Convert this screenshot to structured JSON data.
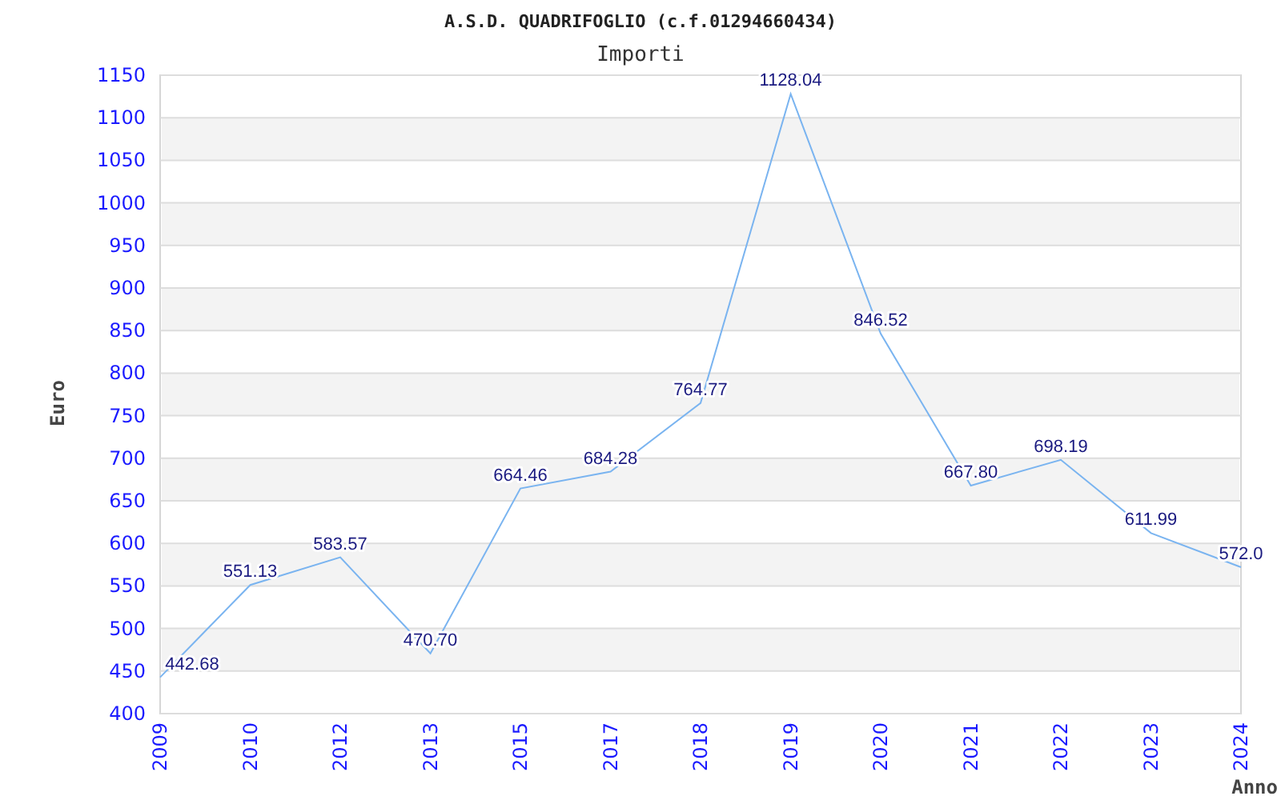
{
  "title": "A.S.D. QUADRIFOGLIO (c.f.01294660434)",
  "chart_data": {
    "type": "line",
    "title": "Importi",
    "xlabel": "Anno",
    "ylabel": "Euro",
    "categories": [
      "2009",
      "2010",
      "2012",
      "2013",
      "2015",
      "2017",
      "2018",
      "2019",
      "2020",
      "2021",
      "2022",
      "2023",
      "2024"
    ],
    "grid": true,
    "series": [
      {
        "color": "#7ab4f0",
        "values": [
          442.68,
          551.13,
          583.57,
          470.7,
          664.46,
          684.28,
          764.77,
          1128.04,
          846.52,
          667.8,
          698.19,
          611.99,
          572.0
        ]
      }
    ],
    "value_labels": [
      "442.68",
      "551.13",
      "583.57",
      "470.70",
      "664.46",
      "684.28",
      "764.77",
      "1128.04",
      "846.52",
      "667.80",
      "698.19",
      "611.99",
      "572.0"
    ],
    "ylim": [
      400,
      1150
    ],
    "yticks": [
      400,
      450,
      500,
      550,
      600,
      650,
      700,
      750,
      800,
      850,
      900,
      950,
      1000,
      1050,
      1100,
      1150
    ]
  }
}
